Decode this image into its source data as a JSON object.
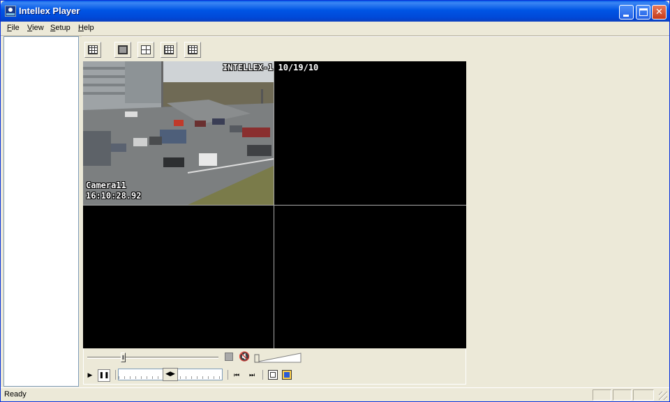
{
  "window": {
    "title": "Intellex Player"
  },
  "menu": {
    "file": "File",
    "view": "View",
    "setup": "Setup",
    "help": "Help"
  },
  "layout_buttons": [
    "custom-layout-icon",
    "single-view-icon",
    "quad-view-icon",
    "nine-view-icon",
    "sixteen-view-icon"
  ],
  "video": {
    "header_overlay": "INTELLEX-1 10/19/10",
    "camera_name": "Camera11",
    "timestamp": "16:10:28.92"
  },
  "status": {
    "text": "Ready"
  },
  "colors": {
    "titlebar": "#0055e5",
    "video_background": "#000000",
    "window_face": "#ece9d8"
  }
}
